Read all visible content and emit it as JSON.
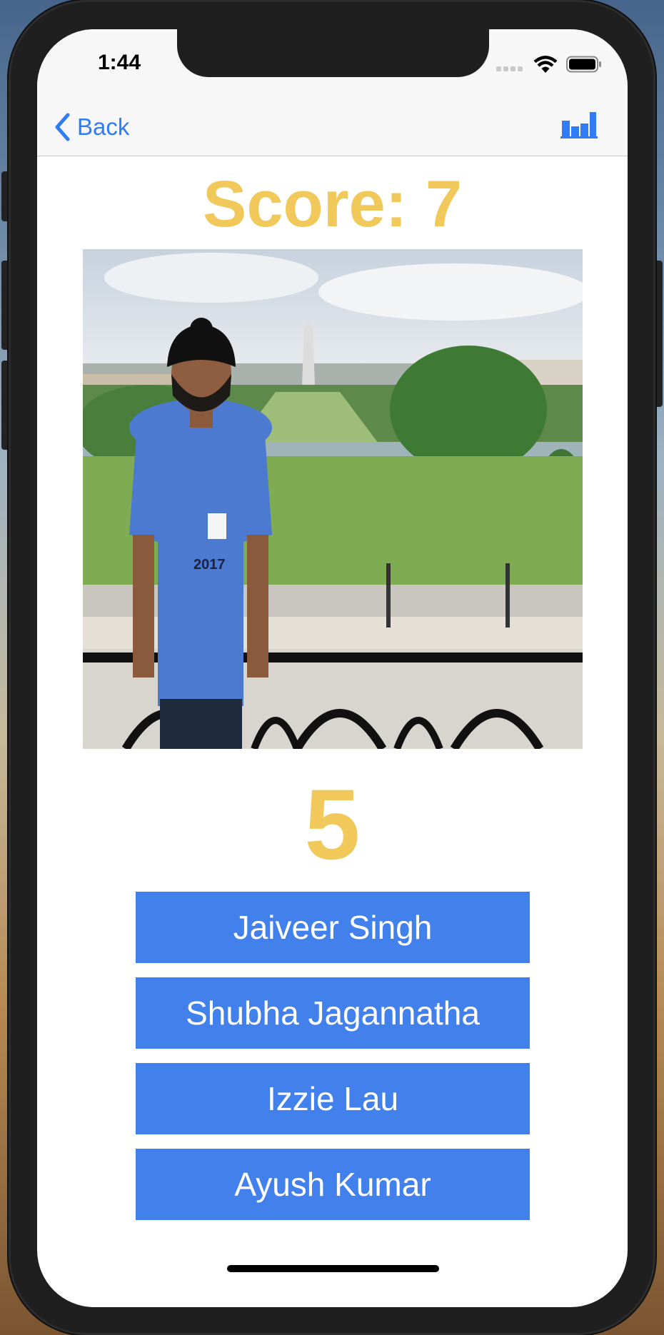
{
  "status_bar": {
    "time": "1:44",
    "icons": [
      "cellular-signal-icon",
      "wifi-icon",
      "battery-icon"
    ]
  },
  "nav": {
    "back_label": "Back",
    "back_icon": "chevron-left-icon",
    "right_icon": "bar-chart-icon"
  },
  "game": {
    "score_text": "Score: 7",
    "countdown": "5",
    "photo_icon": "person-photo-icon",
    "answers": [
      {
        "label": "Jaiveer Singh"
      },
      {
        "label": "Shubha Jagannatha"
      },
      {
        "label": "Izzie Lau"
      },
      {
        "label": "Ayush Kumar"
      }
    ]
  },
  "colors": {
    "accent_blue": "#2f7cf6",
    "button_blue": "#4281ec",
    "score_gold": "#f0c95a",
    "background": "#ffffff"
  }
}
